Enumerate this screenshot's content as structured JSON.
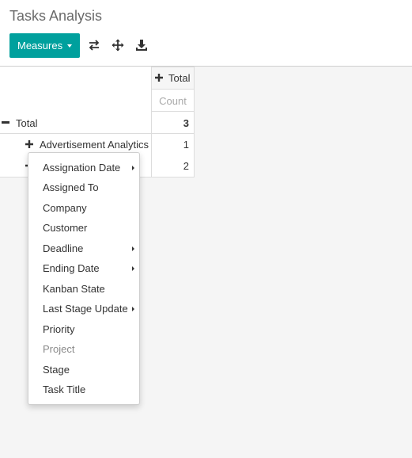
{
  "page": {
    "title": "Tasks Analysis"
  },
  "toolbar": {
    "measures_label": "Measures",
    "icons": [
      "flip-axis-icon",
      "expand-all-icon",
      "download-icon"
    ]
  },
  "pivot": {
    "column_header": "Total",
    "measure": "Count",
    "rows": [
      {
        "label": "Total",
        "value": "3",
        "expanded": true
      },
      {
        "label": "Advertisement Analytics",
        "value": "1",
        "expanded": false
      },
      {
        "label": "",
        "value": "2",
        "expanded": false
      }
    ]
  },
  "groupby_menu": {
    "items": [
      {
        "label": "Assignation Date",
        "submenu": true
      },
      {
        "label": "Assigned To",
        "submenu": false
      },
      {
        "label": "Company",
        "submenu": false
      },
      {
        "label": "Customer",
        "submenu": false
      },
      {
        "label": "Deadline",
        "submenu": true
      },
      {
        "label": "Ending Date",
        "submenu": true
      },
      {
        "label": "Kanban State",
        "submenu": false
      },
      {
        "label": "Last Stage Update",
        "submenu": true
      },
      {
        "label": "Priority",
        "submenu": false
      },
      {
        "label": "Project",
        "submenu": false,
        "disabled": true
      },
      {
        "label": "Stage",
        "submenu": false
      },
      {
        "label": "Task Title",
        "submenu": false
      }
    ]
  },
  "colors": {
    "accent": "#00a09d"
  }
}
